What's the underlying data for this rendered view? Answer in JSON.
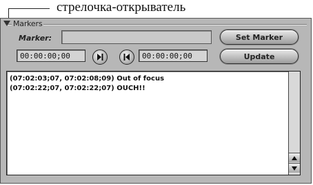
{
  "annotation": {
    "label": "стрелочка-открыватель"
  },
  "markers_panel": {
    "title": "Markers",
    "marker_label": "Marker:",
    "marker_value": "",
    "set_marker_label": "Set Marker",
    "update_label": "Update",
    "timecode_in": "00:00:00;00",
    "timecode_out": "00:00:00;00",
    "log": [
      "(07:02:03;07, 07:02:08;09) Out of focus",
      "(07:02:22;07, 07:02:22;07) OUCH!!"
    ]
  },
  "icons": {
    "disclosure": "disclosure-triangle-icon",
    "next": "step-forward-icon",
    "prev": "step-back-icon",
    "scroll_up": "arrow-up-icon",
    "scroll_down": "arrow-down-icon"
  }
}
